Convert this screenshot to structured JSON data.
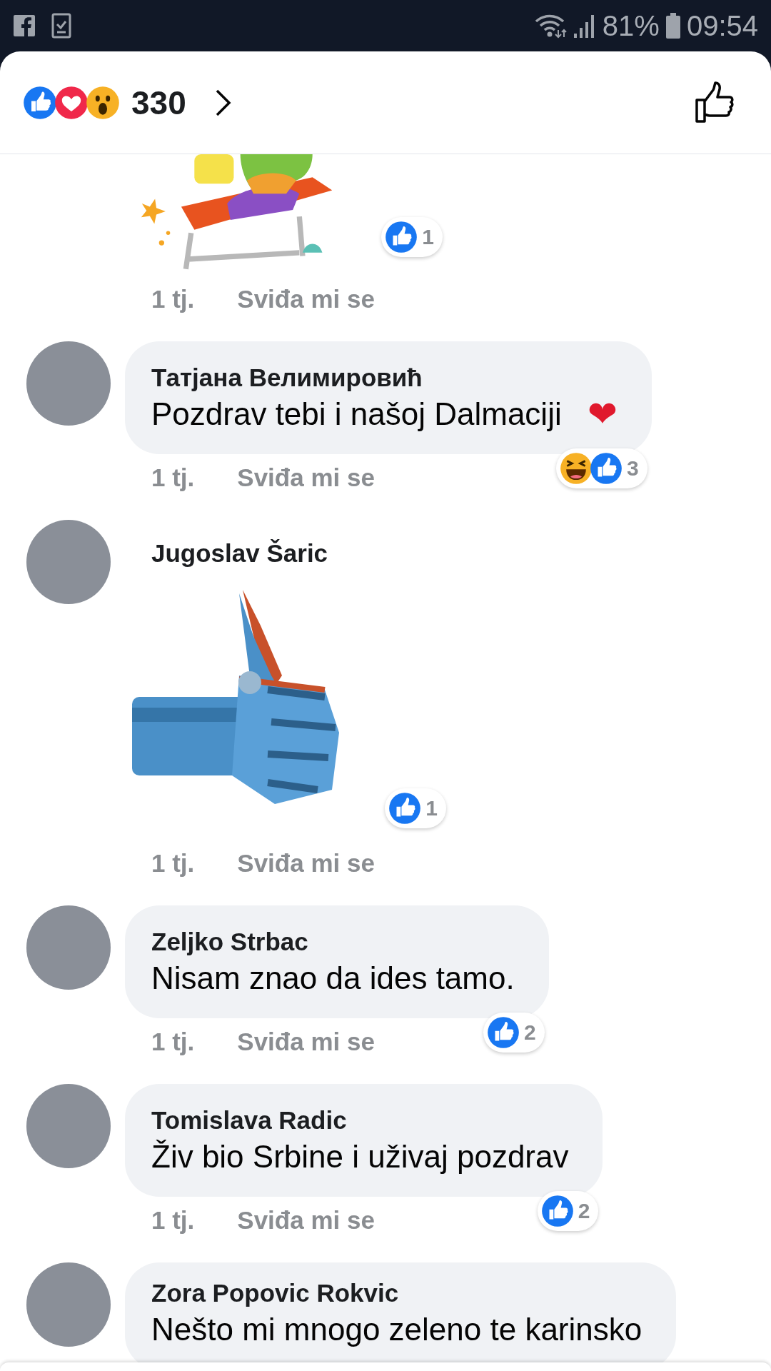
{
  "status_bar": {
    "battery": "81%",
    "time": "09:54"
  },
  "header": {
    "reactions": [
      {
        "kind": "like"
      },
      {
        "kind": "love"
      },
      {
        "kind": "wow"
      }
    ],
    "count": "330"
  },
  "comments": [
    {
      "kind": "sticker",
      "sticker": {
        "kind": "turtle"
      },
      "cropped": true,
      "reactions": {
        "types": [
          {
            "kind": "like"
          }
        ],
        "count": "1"
      },
      "time": "1 tj.",
      "like_label": "Sviđa mi se"
    },
    {
      "kind": "text",
      "author": "Татјана Велимировић",
      "text": "Pozdrav tebi i našoj Dalmaciji",
      "emoji": "❤",
      "reactions": {
        "types": [
          {
            "kind": "haha"
          },
          {
            "kind": "like"
          }
        ],
        "count": "3"
      },
      "time": "1 tj.",
      "like_label": "Sviđa mi se"
    },
    {
      "kind": "sticker",
      "author": "Jugoslav Šaric",
      "sticker": {
        "kind": "robot-hand"
      },
      "cropped": false,
      "reactions": {
        "types": [
          {
            "kind": "like"
          }
        ],
        "count": "1"
      },
      "time": "1 tj.",
      "like_label": "Sviđa mi se"
    },
    {
      "kind": "text",
      "author": "Zeljko Strbac",
      "text": "Nisam znao da ides tamo.",
      "reactions": {
        "types": [
          {
            "kind": "like"
          }
        ],
        "count": "2"
      },
      "time": "1 tj.",
      "like_label": "Sviđa mi se"
    },
    {
      "kind": "text",
      "author": "Tomislava Radic",
      "text": "Živ bio Srbine i uživaj pozdrav",
      "reactions": {
        "types": [
          {
            "kind": "like"
          }
        ],
        "count": "2"
      },
      "time": "1 tj.",
      "like_label": "Sviđa mi se"
    },
    {
      "kind": "text",
      "author": "Zora Popovic Rokvic",
      "text": "Nešto mi mnogo zeleno te karinsko"
    }
  ]
}
